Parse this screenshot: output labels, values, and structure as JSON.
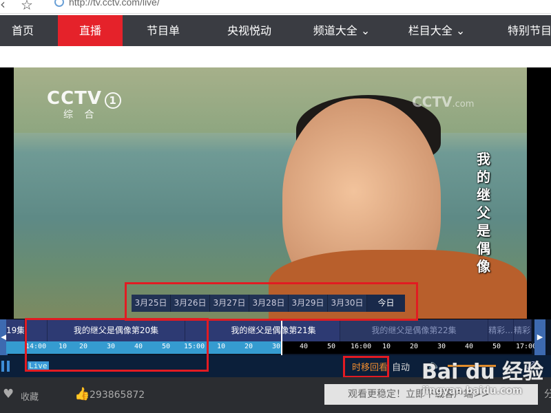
{
  "browser": {
    "url": "http://tv.cctv.com/live/",
    "back_icon": "back-arrow-icon",
    "star_icon": "star-icon",
    "site_icon": "globe-icon"
  },
  "nav": {
    "items": [
      {
        "label": "首页",
        "active": false
      },
      {
        "label": "直播",
        "active": true
      },
      {
        "label": "节目单",
        "active": false
      },
      {
        "label": "央视悦动",
        "active": false
      },
      {
        "label": "频道大全 ⌄",
        "active": false
      },
      {
        "label": "栏目大全 ⌄",
        "active": false
      },
      {
        "label": "特别节目",
        "active": false
      }
    ],
    "accent": "#e5222a",
    "bg": "#3a3c42"
  },
  "video": {
    "channel_logo": "CCTV",
    "channel_number": "1",
    "channel_name": "综 合",
    "watermark": "CCTV",
    "watermark_suffix": ".com",
    "subtitle_chars": [
      "我",
      "的",
      "继",
      "父",
      "是",
      "偶",
      "像"
    ]
  },
  "dates": [
    "3月25日",
    "3月26日",
    "3月27日",
    "3月28日",
    "3月29日",
    "3月30日",
    "今日"
  ],
  "timeline": {
    "programs": [
      {
        "label": "19集",
        "dim": false
      },
      {
        "label": "",
        "dim": false
      },
      {
        "label": "我的继父是偶像第20集",
        "dim": false
      },
      {
        "label": "",
        "dim": false
      },
      {
        "label": "我的继父是偶像第21集",
        "dim": false
      },
      {
        "label": "我的继父是偶像第22集",
        "dim": true
      },
      {
        "label": "精彩...",
        "dim": true
      },
      {
        "label": "精彩节",
        "dim": true
      }
    ],
    "ticks": [
      "14:00",
      "10",
      "20",
      "30",
      "40",
      "50",
      "15:00",
      "10",
      "20",
      "30",
      "40",
      "50",
      "16:00",
      "10",
      "20",
      "30",
      "40",
      "50",
      "17:00"
    ]
  },
  "controls": {
    "live_label": "Live",
    "timeshift_label": "时移回看",
    "auto_label": "自动",
    "volume_icon": "speaker-icon",
    "fullscreen_icon": "fullscreen-icon"
  },
  "bottom": {
    "fav_label": "收藏",
    "count": "293865872",
    "banner_text": "观看更稳定！立即下载客户端>>",
    "edge_text": "分"
  },
  "watermark": {
    "baidu_text": "Bai du 经验",
    "baidu_url": "jingyan.baidu.com"
  }
}
